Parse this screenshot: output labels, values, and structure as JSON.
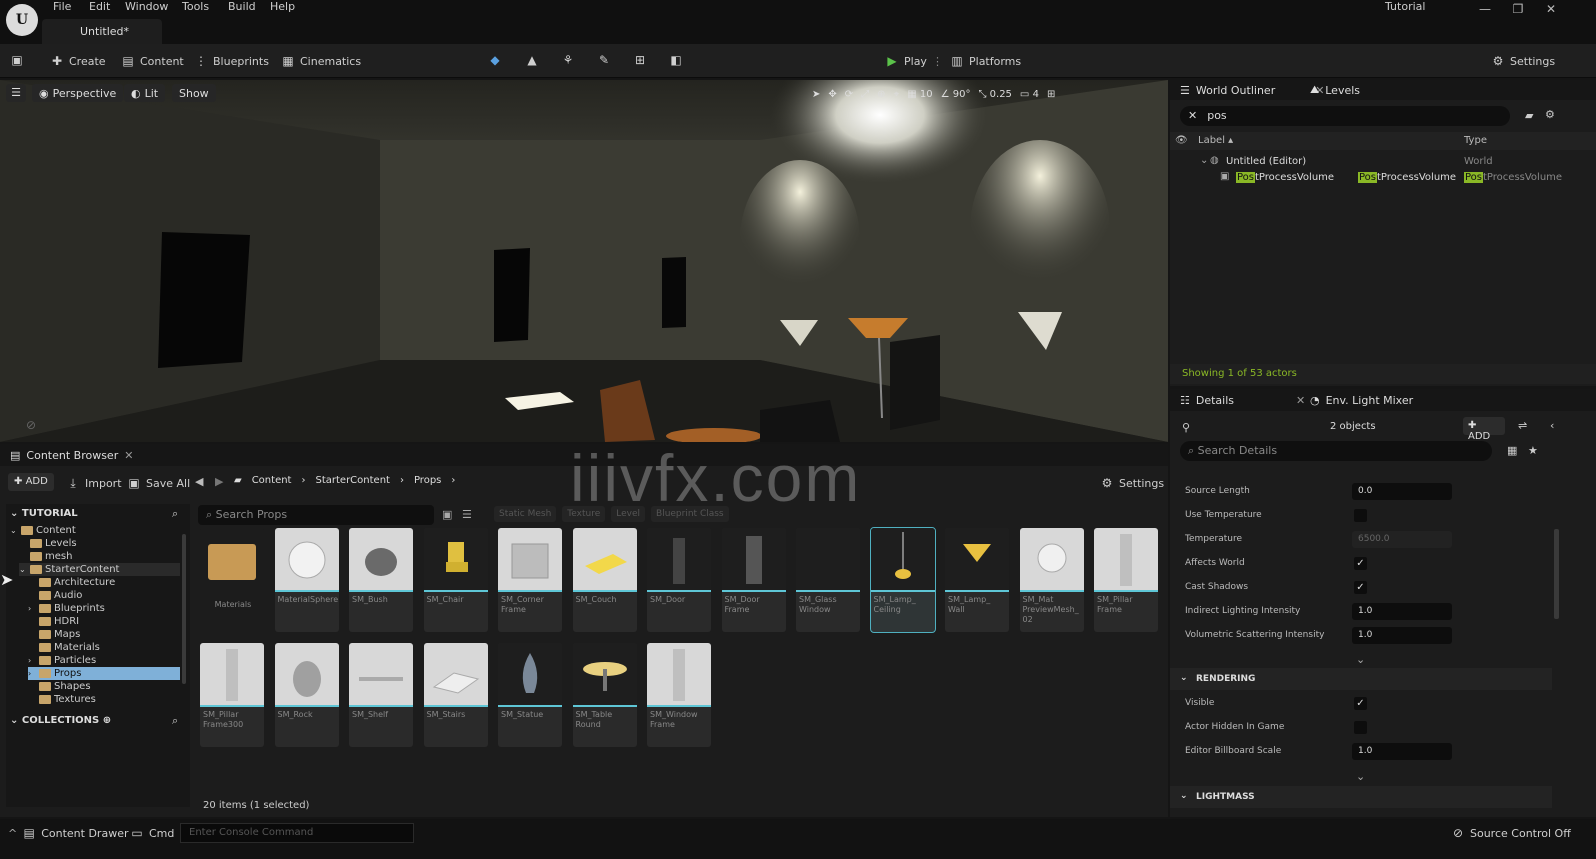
{
  "titlebar": {
    "menu": [
      "File",
      "Edit",
      "Window",
      "Tools",
      "Build",
      "Help"
    ],
    "doc_tab": "Untitled*",
    "project": "Tutorial"
  },
  "toolbar": {
    "create": "Create",
    "content": "Content",
    "blueprints": "Blueprints",
    "cinematics": "Cinematics",
    "play": "Play",
    "platforms": "Platforms",
    "settings": "Settings"
  },
  "viewport": {
    "perspective": "Perspective",
    "lit": "Lit",
    "show": "Show",
    "grid_snap": "10",
    "rot_snap": "90°",
    "scale_snap": "0.25",
    "camera_speed": "4"
  },
  "outliner": {
    "tab": "World Outliner",
    "levels_tab": "Levels",
    "search_value": "pos",
    "col_label": "Label",
    "col_type": "Type",
    "rows": [
      {
        "label": "Untitled (Editor)",
        "type": "World"
      },
      {
        "hl": "Pos",
        "rest": "tProcessVolume",
        "hl2": "Pos",
        "rest2": "tProcessVolume",
        "hl3": "Pos",
        "rest3": "tProcessVolume"
      }
    ],
    "status": "Showing 1 of 53 actors"
  },
  "details": {
    "tab": "Details",
    "mixer_tab": "Env. Light Mixer",
    "objects": "2 objects",
    "add": "ADD",
    "search_placeholder": "Search Details",
    "rows1": [
      {
        "label": "Source Length",
        "value": "0.0",
        "kind": "num"
      },
      {
        "label": "Use Temperature",
        "value": "",
        "kind": "chk"
      },
      {
        "label": "Temperature",
        "value": "6500.0",
        "kind": "dim"
      },
      {
        "label": "Affects World",
        "value": "✓",
        "kind": "chk"
      },
      {
        "label": "Cast Shadows",
        "value": "✓",
        "kind": "chk"
      },
      {
        "label": "Indirect Lighting Intensity",
        "value": "1.0",
        "kind": "num"
      },
      {
        "label": "Volumetric Scattering Intensity",
        "value": "1.0",
        "kind": "num"
      }
    ],
    "rendering": "RENDERING",
    "rows2": [
      {
        "label": "Visible",
        "value": "✓",
        "kind": "chk"
      },
      {
        "label": "Actor Hidden In Game",
        "value": "",
        "kind": "chk"
      },
      {
        "label": "Editor Billboard Scale",
        "value": "1.0",
        "kind": "num"
      }
    ],
    "lightmass": "LIGHTMASS"
  },
  "content_browser": {
    "tab": "Content Browser",
    "add": "ADD",
    "import": "Import",
    "save_all": "Save All",
    "crumbs": [
      "Content",
      "StarterContent",
      "Props"
    ],
    "settings": "Settings",
    "tree_title": "TUTORIAL",
    "collections": "COLLECTIONS",
    "tree": [
      {
        "label": "Content",
        "level": 0,
        "arrow": "v"
      },
      {
        "label": "Levels",
        "level": 1,
        "arrow": ""
      },
      {
        "label": "mesh",
        "level": 1,
        "arrow": ""
      },
      {
        "label": "StarterContent",
        "level": 1,
        "arrow": "v"
      },
      {
        "label": "Architecture",
        "level": 2,
        "arrow": ""
      },
      {
        "label": "Audio",
        "level": 2,
        "arrow": ""
      },
      {
        "label": "Blueprints",
        "level": 2,
        "arrow": ">"
      },
      {
        "label": "HDRI",
        "level": 2,
        "arrow": ""
      },
      {
        "label": "Maps",
        "level": 2,
        "arrow": ""
      },
      {
        "label": "Materials",
        "level": 2,
        "arrow": ""
      },
      {
        "label": "Particles",
        "level": 2,
        "arrow": ">"
      },
      {
        "label": "Props",
        "level": 2,
        "arrow": ">"
      },
      {
        "label": "Shapes",
        "level": 2,
        "arrow": ""
      },
      {
        "label": "Textures",
        "level": 2,
        "arrow": ""
      }
    ],
    "search_placeholder": "Search Props",
    "filters": [
      "Static Mesh",
      "Texture",
      "Level",
      "Blueprint Class"
    ],
    "assets": [
      "Materials",
      "MaterialSphere",
      "SM_Bush",
      "SM_Chair",
      "SM_Corner Frame",
      "SM_Couch",
      "SM_Door",
      "SM_Door Frame",
      "SM_Glass Window",
      "SM_Lamp_ Ceiling",
      "SM_Lamp_ Wall",
      "SM_Mat PreviewMesh_ 02",
      "SM_Pillar Frame",
      "SM_Pillar Frame300",
      "SM_Rock",
      "SM_Shelf",
      "SM_Stairs",
      "SM_Statue",
      "SM_Table Round",
      "SM_Window Frame"
    ],
    "status": "20 items (1 selected)"
  },
  "bottombar": {
    "drawer": "Content Drawer",
    "cmd": "Cmd",
    "console_placeholder": "Enter Console Command",
    "source_control": "Source Control Off"
  },
  "watermark": "iiivfx.com"
}
